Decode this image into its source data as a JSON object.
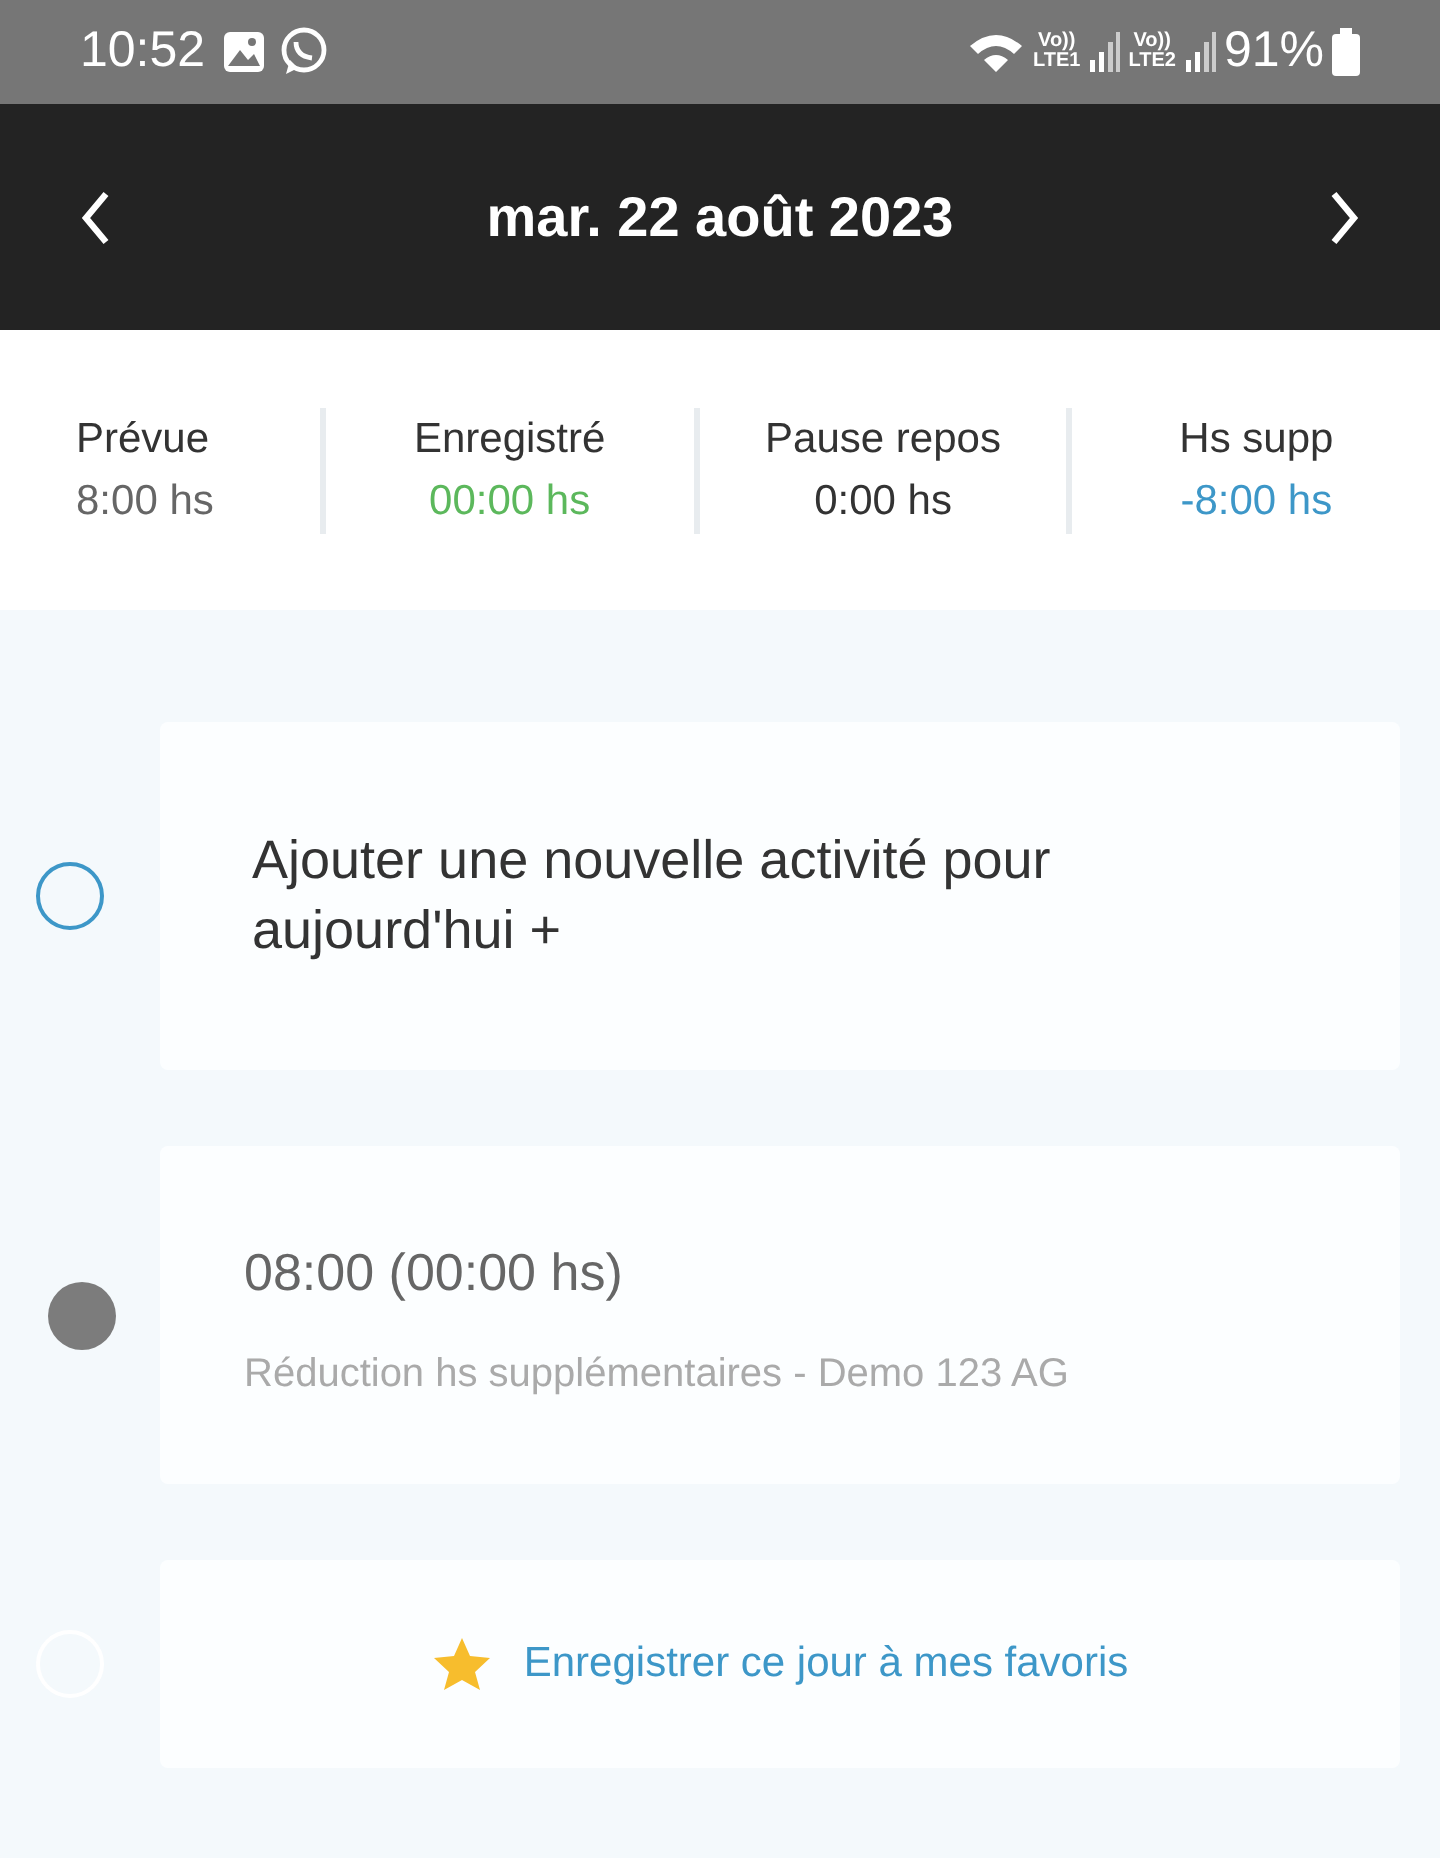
{
  "status_bar": {
    "time": "10:52",
    "sims": [
      {
        "top": "Vo))",
        "bottom": "LTE1"
      },
      {
        "top": "Vo))",
        "bottom": "LTE2"
      }
    ],
    "battery": "91%"
  },
  "header": {
    "title": "mar. 22 août 2023"
  },
  "summary": [
    {
      "label": "Prévue",
      "value": "8:00 hs",
      "color": "#666666"
    },
    {
      "label": "Enregistré",
      "value": "00:00 hs",
      "color": "#5cb85c"
    },
    {
      "label": "Pause repos",
      "value": "0:00 hs",
      "color": "#333333"
    },
    {
      "label": "Hs supp",
      "value": "-8:00 hs",
      "color": "#3d97c8"
    }
  ],
  "timeline": [
    {
      "kind": "add",
      "text": "Ajouter une nouvelle activité pour aujourd'hui +"
    },
    {
      "kind": "entry",
      "time": "08:00 (00:00 hs)",
      "detail": "Réduction hs supplémentaires - Demo 123 AG"
    },
    {
      "kind": "favorite",
      "text": "Enregistrer ce jour à mes favoris"
    }
  ]
}
